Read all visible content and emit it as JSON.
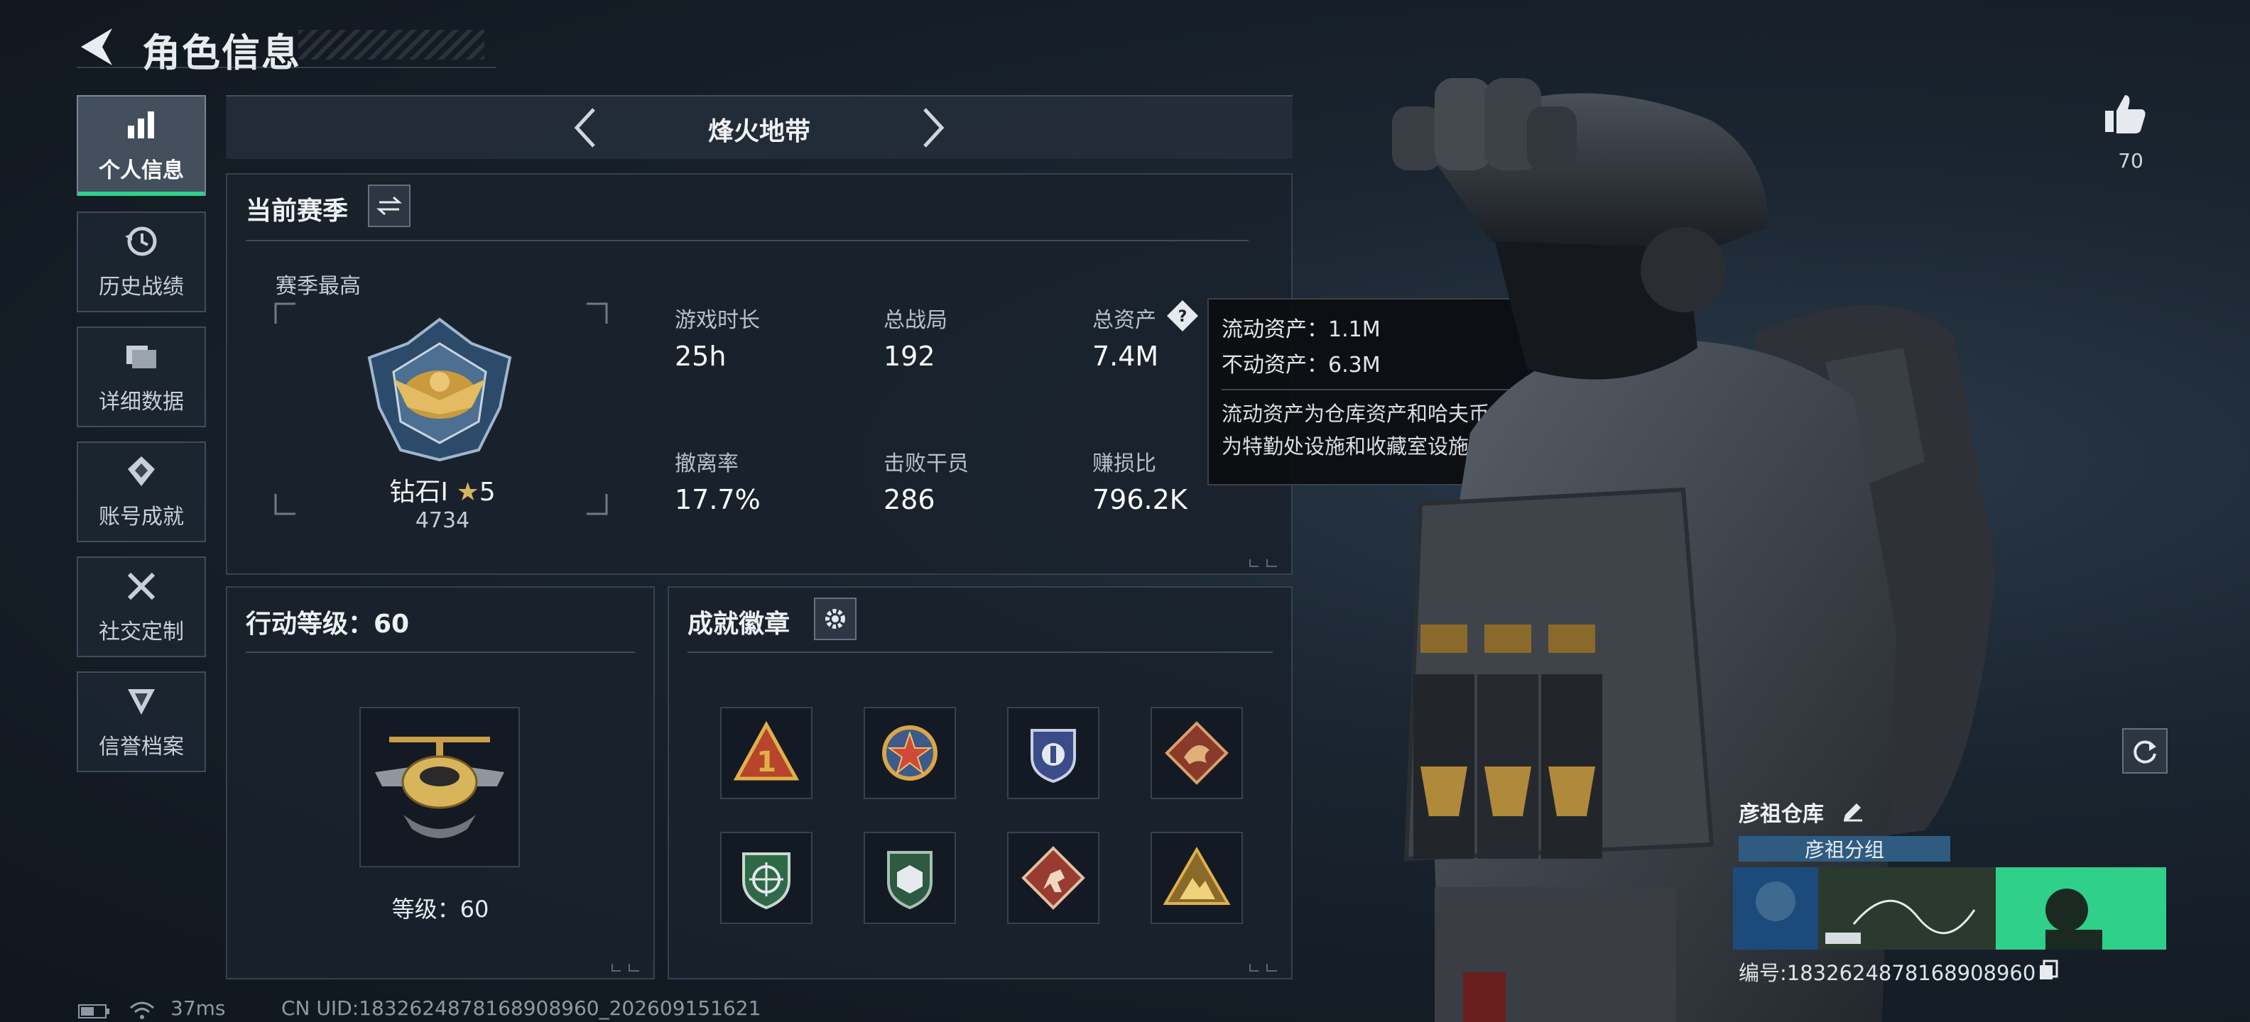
{
  "header": {
    "title": "角色信息"
  },
  "sidebar": {
    "items": [
      {
        "label": "个人信息",
        "icon": "bar-chart-icon",
        "active": true
      },
      {
        "label": "历史战绩",
        "icon": "history-clock-icon"
      },
      {
        "label": "详细数据",
        "icon": "folder-icon"
      },
      {
        "label": "账号成就",
        "icon": "achievement-icon"
      },
      {
        "label": "社交定制",
        "icon": "tools-icon"
      },
      {
        "label": "信誉档案",
        "icon": "shield-rank-icon"
      }
    ]
  },
  "map_selector": {
    "name": "烽火地带"
  },
  "season": {
    "title": "当前赛季",
    "best_label": "赛季最高",
    "rank_name": "钻石Ⅰ",
    "rank_stars": "5",
    "rank_points": "4734",
    "stats": [
      {
        "label": "游戏时长",
        "value": "25h"
      },
      {
        "label": "总战局",
        "value": "192"
      },
      {
        "label": "总资产",
        "value": "7.4M"
      },
      {
        "label": "撤离率",
        "value": "17.7%"
      },
      {
        "label": "击败干员",
        "value": "286"
      },
      {
        "label": "赚损比",
        "value": "796.2K"
      }
    ]
  },
  "tooltip": {
    "liquid": "流动资产：1.1M",
    "fixed": "不动资产：6.3M",
    "desc_line1": "流动资产为仓库资产和哈夫币，不动资产",
    "desc_line2": "为特勤处设施和收藏室设施"
  },
  "action_level": {
    "title": "行动等级：60",
    "level_text": "等级：60"
  },
  "badges": {
    "title": "成就徽章",
    "items": [
      "rank-1-triangle-badge",
      "star-compass-badge",
      "police-shield-badge",
      "dragon-diamond-badge",
      "green-crosshair-shield-badge",
      "green-hex-shield-badge",
      "climber-diamond-badge",
      "mountain-triangle-badge"
    ]
  },
  "profile": {
    "likes": "70",
    "warehouse_name": "彦祖仓库",
    "group_name": "彦祖分组",
    "id_text": "编号:1832624878168908960"
  },
  "status": {
    "ping": "37ms",
    "uid": "CN UID:1832624878168908960_202609151621"
  },
  "colors": {
    "accent": "#2fd08a",
    "tag_blue": "#2f5b80"
  }
}
